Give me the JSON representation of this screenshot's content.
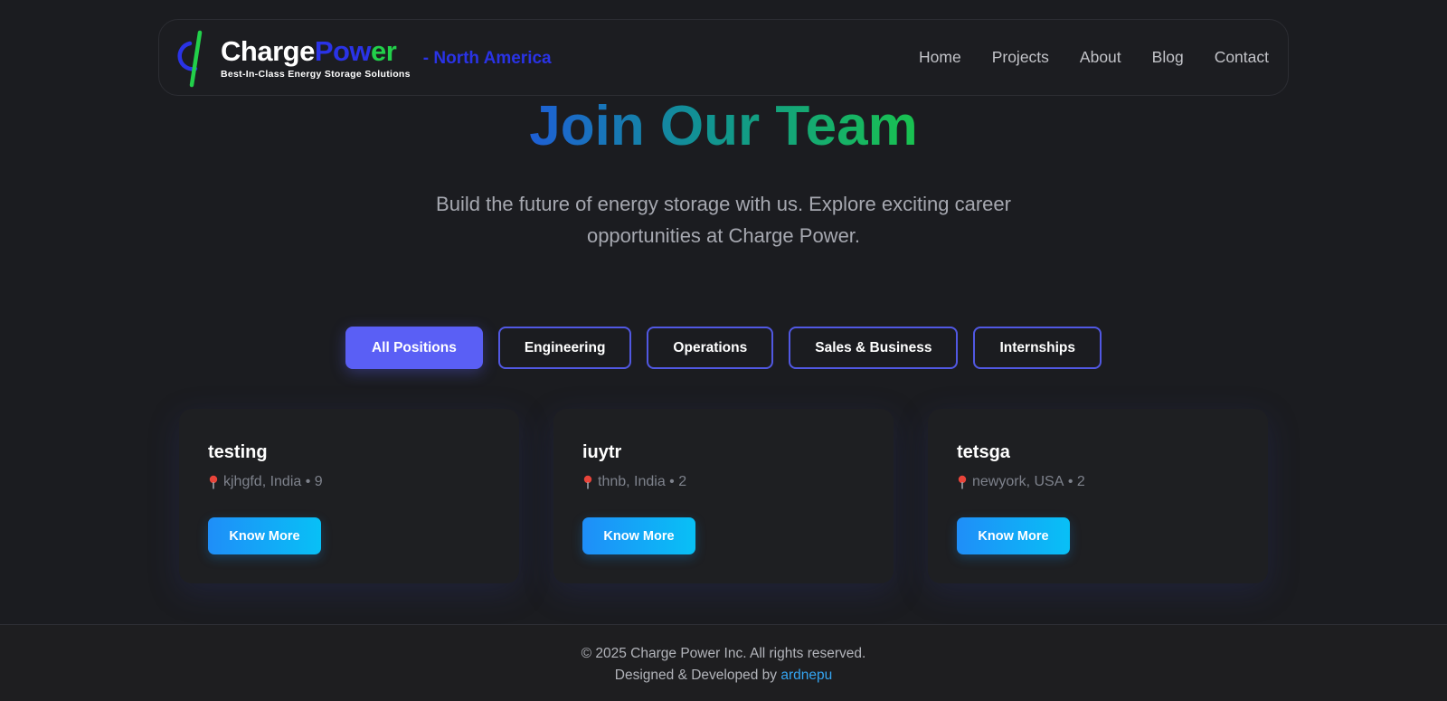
{
  "header": {
    "brand_part1": "Charge",
    "brand_part2": "Pow",
    "brand_part3": "er",
    "tagline": "Best-In-Class Energy Storage Solutions",
    "region": "- North America",
    "nav": [
      "Home",
      "Projects",
      "About",
      "Blog",
      "Contact"
    ]
  },
  "hero": {
    "title": "Join Our Team",
    "subtitle": "Build the future of energy storage with us. Explore exciting career opportunities at Charge Power."
  },
  "filters": {
    "items": [
      "All Positions",
      "Engineering",
      "Operations",
      "Sales & Business",
      "Internships"
    ],
    "active": "All Positions"
  },
  "jobs": [
    {
      "title": "testing",
      "location": "kjhgfd, India",
      "count": "9",
      "button": "Know More"
    },
    {
      "title": "iuytr",
      "location": "thnb, India",
      "count": "2",
      "button": "Know More"
    },
    {
      "title": "tetsga",
      "location": "newyork, USA",
      "count": "2",
      "button": "Know More"
    }
  ],
  "footer": {
    "copyright": "© 2025 Charge Power Inc. All rights reserved.",
    "credit_prefix": "Designed & Developed by ",
    "credit_name": "ardnepu"
  },
  "colors": {
    "background": "#1b1c20",
    "accent": "#5a5ff5",
    "brand_blue": "#2a33e6",
    "brand_green": "#22d04a",
    "button_gradient_start": "#1f8ef8",
    "button_gradient_end": "#08c0f6",
    "link": "#34a4f0"
  },
  "icons": {
    "logo": "power-symbol-logo",
    "location": "map-pin-icon"
  }
}
